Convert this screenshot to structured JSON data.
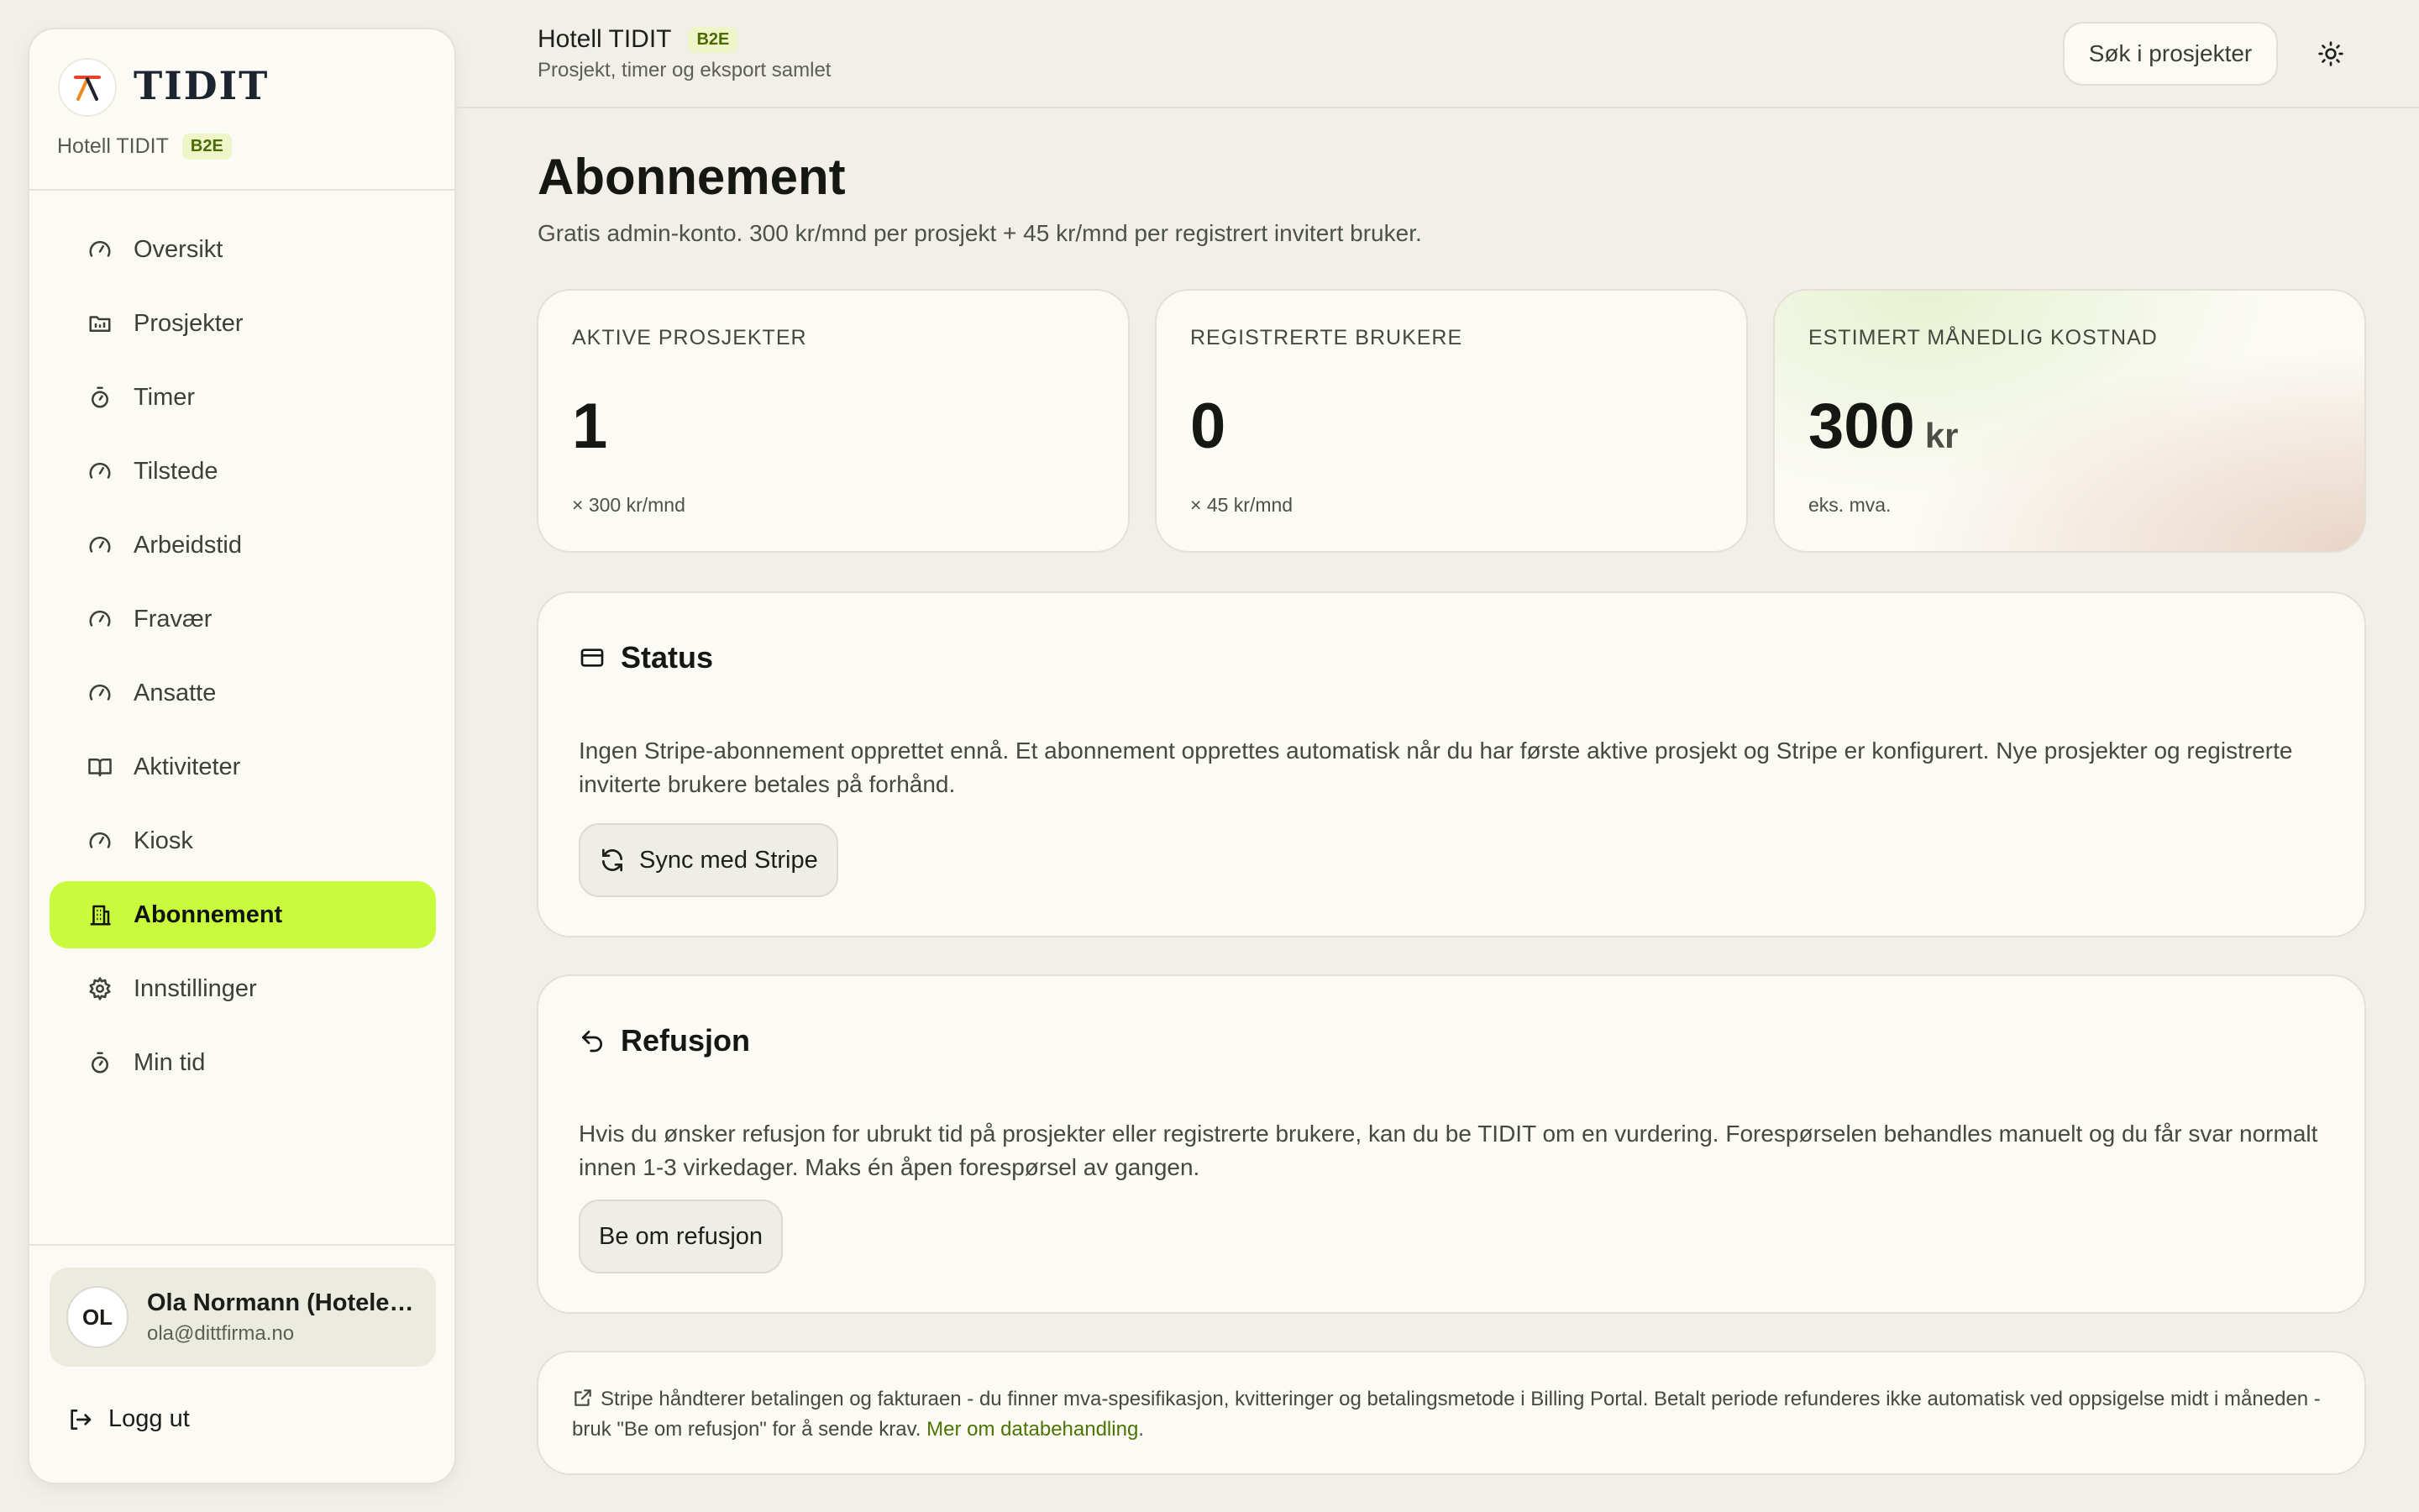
{
  "brand": {
    "name": "TIDIT",
    "org": "Hotell TIDIT",
    "badge": "B2E"
  },
  "nav": [
    {
      "label": "Oversikt",
      "icon": "gauge-icon"
    },
    {
      "label": "Prosjekter",
      "icon": "folder-icon"
    },
    {
      "label": "Timer",
      "icon": "stopwatch-icon"
    },
    {
      "label": "Tilstede",
      "icon": "gauge-icon"
    },
    {
      "label": "Arbeidstid",
      "icon": "gauge-icon"
    },
    {
      "label": "Fravær",
      "icon": "gauge-icon"
    },
    {
      "label": "Ansatte",
      "icon": "gauge-icon"
    },
    {
      "label": "Aktiviteter",
      "icon": "book-icon"
    },
    {
      "label": "Kiosk",
      "icon": "gauge-icon"
    },
    {
      "label": "Abonnement",
      "icon": "building-icon",
      "active": true
    },
    {
      "label": "Innstillinger",
      "icon": "gear-icon"
    },
    {
      "label": "Min tid",
      "icon": "stopwatch-icon"
    }
  ],
  "user": {
    "initials": "OL",
    "name": "Ola Normann (Hotelei...",
    "email": "ola@dittfirma.no"
  },
  "logout_label": "Logg ut",
  "header": {
    "title": "Hotell TIDIT",
    "badge": "B2E",
    "subtitle": "Prosjekt, timer og eksport samlet",
    "search_label": "Søk i prosjekter"
  },
  "page": {
    "title": "Abonnement",
    "subtitle": "Gratis admin-konto. 300 kr/mnd per prosjekt + 45 kr/mnd per registrert invitert bruker."
  },
  "stats": [
    {
      "label": "AKTIVE PROSJEKTER",
      "value": "1",
      "unit": "",
      "foot": "× 300 kr/mnd"
    },
    {
      "label": "REGISTRERTE BRUKERE",
      "value": "0",
      "unit": "",
      "foot": "× 45 kr/mnd"
    },
    {
      "label": "ESTIMERT MÅNEDLIG KOSTNAD",
      "value": "300",
      "unit": "kr",
      "foot": "eks. mva."
    }
  ],
  "status_card": {
    "title": "Status",
    "text": "Ingen Stripe-abonnement opprettet ennå. Et abonnement opprettes automatisk når du har første aktive prosjekt og Stripe er konfigurert. Nye prosjekter og registrerte inviterte brukere betales på forhånd.",
    "button": "Sync med Stripe"
  },
  "refund_card": {
    "title": "Refusjon",
    "text": "Hvis du ønsker refusjon for ubrukt tid på prosjekter eller registrerte brukere, kan du be TIDIT om en vurdering. Forespørselen behandles manuelt og du får svar normalt innen 1-3 virkedager. Maks én åpen forespørsel av gangen.",
    "button": "Be om refusjon"
  },
  "footnote": {
    "text": "Stripe håndterer betalingen og fakturaen - du finner mva-spesifikasjon, kvitteringer og betalingsmetode i Billing Portal. Betalt periode refunderes ikke automatisk ved oppsigelse midt i måneden - bruk \"Be om refusjon\" for å sende krav.",
    "link": "Mer om databehandling",
    "end": "."
  },
  "colors": {
    "accent": "#c8fb3c",
    "background": "#f1efe8",
    "card": "#fbfaf5",
    "link": "#4d7400"
  }
}
